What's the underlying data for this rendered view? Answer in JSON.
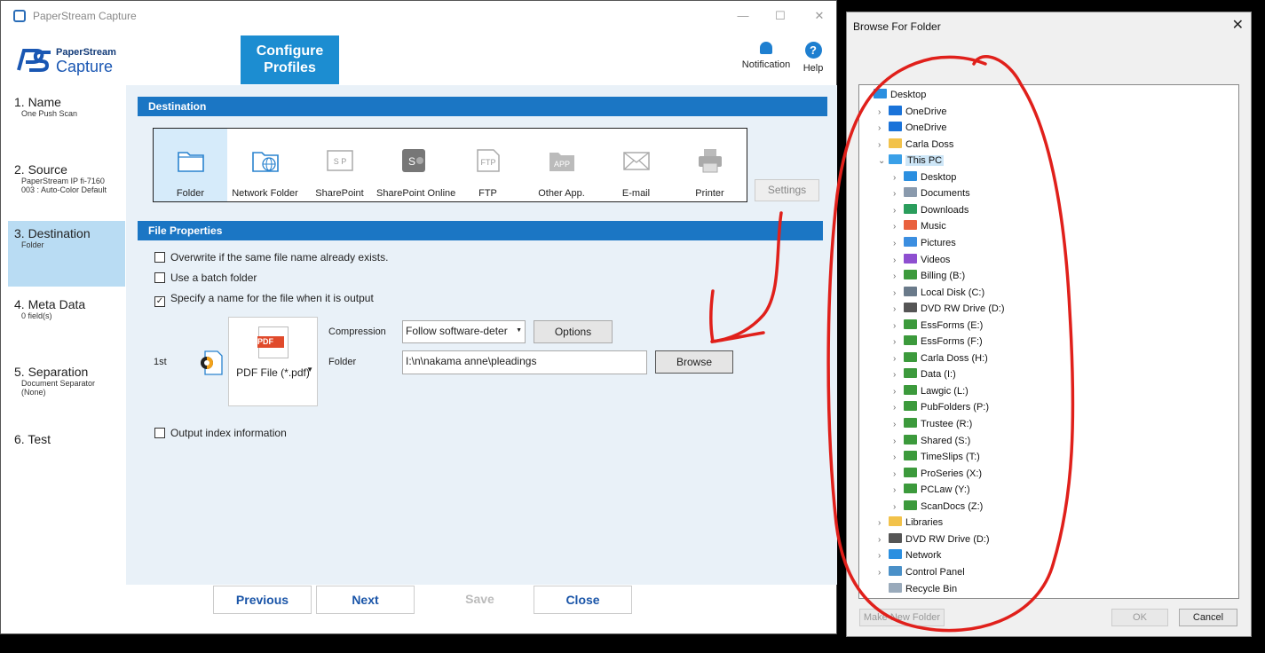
{
  "window": {
    "title": "PaperStream Capture",
    "minimize": "—",
    "maximize": "☐",
    "close": "✕"
  },
  "logo": {
    "line1": "PaperStream",
    "line2": "Capture"
  },
  "banner": {
    "line1": "Configure",
    "line2": "Profiles"
  },
  "top_actions": {
    "notification": "Notification",
    "help": "Help",
    "help_glyph": "?"
  },
  "steps": [
    {
      "title": "1. Name",
      "sub": [
        "One Push Scan"
      ]
    },
    {
      "title": "2. Source",
      "sub": [
        "PaperStream IP fi-7160",
        "003 : Auto-Color Default"
      ]
    },
    {
      "title": "3. Destination",
      "sub": [
        "Folder"
      ]
    },
    {
      "title": "4. Meta Data",
      "sub": [
        "0 field(s)"
      ]
    },
    {
      "title": "5. Separation",
      "sub": [
        "Document Separator",
        "(None)"
      ]
    },
    {
      "title": "6. Test",
      "sub": []
    }
  ],
  "destination": {
    "header": "Destination",
    "items": [
      {
        "label": "Folder",
        "icon": "folder-icon"
      },
      {
        "label": "Network Folder",
        "icon": "network-folder-icon"
      },
      {
        "label": "SharePoint",
        "icon": "sharepoint-icon",
        "glyph": "S P"
      },
      {
        "label": "SharePoint Online",
        "icon": "sharepoint-online-icon",
        "glyph": "S"
      },
      {
        "label": "FTP",
        "icon": "ftp-icon",
        "glyph": "FTP"
      },
      {
        "label": "Other App.",
        "icon": "other-app-icon",
        "glyph": "APP"
      },
      {
        "label": "E-mail",
        "icon": "email-icon"
      },
      {
        "label": "Printer",
        "icon": "printer-icon"
      }
    ],
    "settings_label": "Settings"
  },
  "file_properties": {
    "header": "File Properties",
    "overwrite": "Overwrite if the same file name already exists.",
    "batch": "Use a batch folder",
    "specify": "Specify a name for the file when it is output",
    "check_glyph": "✓",
    "order": "1st",
    "format_label": "PDF File (*.pdf)",
    "pdf_tag": "PDF",
    "compression_label": "Compression",
    "compression_value": "Follow software-deter",
    "options_label": "Options",
    "folder_label": "Folder",
    "folder_value": "I:\\n\\nakama anne\\pleadings",
    "browse_label": "Browse",
    "index_info": "Output index information"
  },
  "nav": {
    "previous": "Previous",
    "next": "Next",
    "save": "Save",
    "close": "Close"
  },
  "dialog": {
    "title": "Browse For Folder",
    "close": "✕",
    "tree": [
      {
        "label": "Desktop",
        "level": 0,
        "expander": "",
        "icon": "desktop-icon"
      },
      {
        "label": "OneDrive",
        "level": 1,
        "expander": "›",
        "icon": "cloud-icon"
      },
      {
        "label": "OneDrive",
        "level": 1,
        "expander": "›",
        "icon": "cloud-icon"
      },
      {
        "label": "Carla Doss",
        "level": 1,
        "expander": "›",
        "icon": "user-folder-icon"
      },
      {
        "label": "This PC",
        "level": 1,
        "expander": "⌄",
        "icon": "computer-icon",
        "selected": true
      },
      {
        "label": "Desktop",
        "level": 2,
        "expander": "›",
        "icon": "desktop-icon"
      },
      {
        "label": "Documents",
        "level": 2,
        "expander": "›",
        "icon": "documents-icon"
      },
      {
        "label": "Downloads",
        "level": 2,
        "expander": "›",
        "icon": "downloads-icon"
      },
      {
        "label": "Music",
        "level": 2,
        "expander": "›",
        "icon": "music-icon"
      },
      {
        "label": "Pictures",
        "level": 2,
        "expander": "›",
        "icon": "pictures-icon"
      },
      {
        "label": "Videos",
        "level": 2,
        "expander": "›",
        "icon": "videos-icon"
      },
      {
        "label": "Billing (B:)",
        "level": 2,
        "expander": "›",
        "icon": "network-drive-icon"
      },
      {
        "label": "Local Disk (C:)",
        "level": 2,
        "expander": "›",
        "icon": "local-disk-icon"
      },
      {
        "label": "DVD RW Drive (D:)",
        "level": 2,
        "expander": "›",
        "icon": "dvd-drive-icon"
      },
      {
        "label": "EssForms (E:)",
        "level": 2,
        "expander": "›",
        "icon": "network-drive-icon"
      },
      {
        "label": "EssForms (F:)",
        "level": 2,
        "expander": "›",
        "icon": "network-drive-icon"
      },
      {
        "label": "Carla Doss (H:)",
        "level": 2,
        "expander": "›",
        "icon": "network-drive-icon"
      },
      {
        "label": "Data (I:)",
        "level": 2,
        "expander": "›",
        "icon": "network-drive-icon"
      },
      {
        "label": "Lawgic (L:)",
        "level": 2,
        "expander": "›",
        "icon": "network-drive-icon"
      },
      {
        "label": "PubFolders (P:)",
        "level": 2,
        "expander": "›",
        "icon": "network-drive-icon"
      },
      {
        "label": "Trustee (R:)",
        "level": 2,
        "expander": "›",
        "icon": "network-drive-icon"
      },
      {
        "label": "Shared (S:)",
        "level": 2,
        "expander": "›",
        "icon": "network-drive-icon"
      },
      {
        "label": "TimeSlips (T:)",
        "level": 2,
        "expander": "›",
        "icon": "network-drive-icon"
      },
      {
        "label": "ProSeries (X:)",
        "level": 2,
        "expander": "›",
        "icon": "network-drive-icon"
      },
      {
        "label": "PCLaw (Y:)",
        "level": 2,
        "expander": "›",
        "icon": "network-drive-icon"
      },
      {
        "label": "ScanDocs (Z:)",
        "level": 2,
        "expander": "›",
        "icon": "network-drive-icon"
      },
      {
        "label": "Libraries",
        "level": 1,
        "expander": "›",
        "icon": "libraries-icon"
      },
      {
        "label": "DVD RW Drive (D:)",
        "level": 1,
        "expander": "›",
        "icon": "dvd-drive-icon"
      },
      {
        "label": "Network",
        "level": 1,
        "expander": "›",
        "icon": "network-icon"
      },
      {
        "label": "Control Panel",
        "level": 1,
        "expander": "›",
        "icon": "control-panel-icon"
      },
      {
        "label": "Recycle Bin",
        "level": 1,
        "expander": "",
        "icon": "recycle-bin-icon"
      }
    ],
    "make_new_folder": "Make New Folder",
    "ok": "OK",
    "cancel": "Cancel"
  },
  "colors": {
    "accent": "#1b76c4",
    "annotation": "#e0201b",
    "selection": "#b9dcf3"
  }
}
